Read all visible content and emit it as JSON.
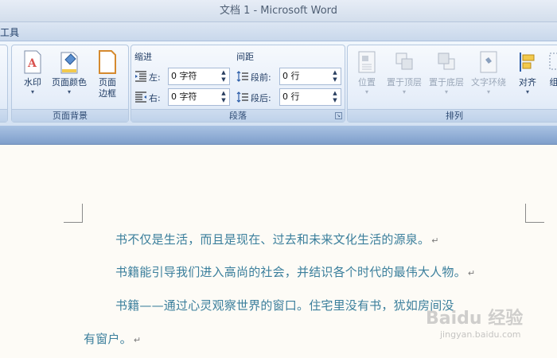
{
  "window": {
    "title": "文档 1 - Microsoft Word"
  },
  "tabrow": {
    "label": "工具"
  },
  "ribbon": {
    "page_background": {
      "caption": "页面背景",
      "watermark_label": "水印",
      "page_color_label": "页面颜色",
      "page_border_label_1": "页面",
      "page_border_label_2": "边框"
    },
    "paragraph": {
      "caption": "段落",
      "indent_header": "缩进",
      "spacing_header": "间距",
      "left_label": "左:",
      "right_label": "右:",
      "before_label": "段前:",
      "after_label": "段后:",
      "left_value": "0 字符",
      "right_value": "0 字符",
      "before_value": "0 行",
      "after_value": "0 行"
    },
    "arrange": {
      "caption": "排列",
      "position_label": "位置",
      "bring_front_label": "置于顶层",
      "send_back_label": "置于底层",
      "text_wrap_label": "文字环绕",
      "align_label": "对齐",
      "group_label": "组"
    }
  },
  "document": {
    "para1": "书不仅是生活，而且是现在、过去和未来文化生活的源泉。",
    "para2": "书籍能引导我们进入高尚的社会，并结识各个时代的最伟大人物。",
    "para3_line1": "书籍——通过心灵观察世界的窗口。住宅里没有书，犹如房间没",
    "para3_line2": "有窗户。",
    "para_mark": "↵"
  },
  "watermark": {
    "logo": "Baidu 经验",
    "url": "jingyan.baidu.com"
  },
  "colors": {
    "text": "#3b7f9c",
    "ribbon": "#dfe9f6",
    "band": "#8eabd4"
  }
}
